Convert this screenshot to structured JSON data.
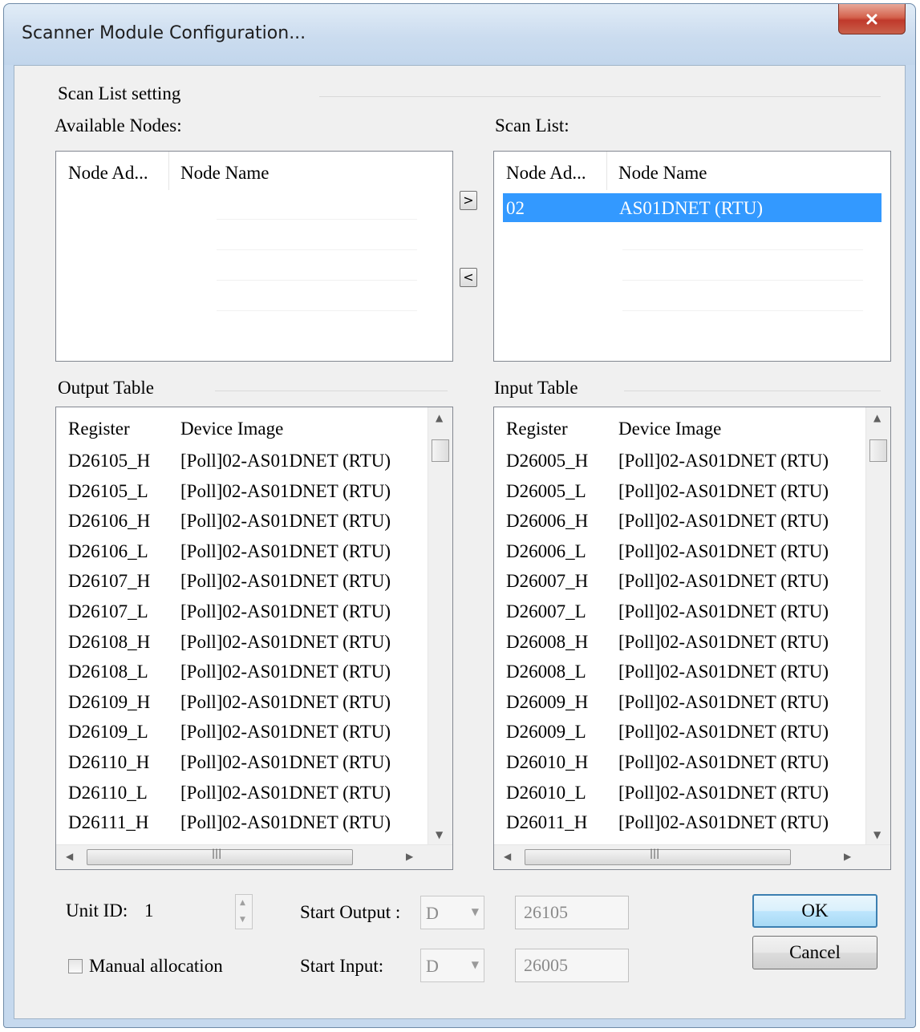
{
  "window": {
    "title": "Scanner Module Configuration..."
  },
  "scan_list_setting": {
    "group_label": "Scan List setting",
    "available_label": "Available Nodes:",
    "scanlist_label": "Scan List:",
    "columns": [
      "Node Ad...",
      "Node Name"
    ],
    "available_nodes": [],
    "scan_list": [
      {
        "address": "02",
        "name": "AS01DNET (RTU)",
        "selected": true
      }
    ],
    "add_button": ">",
    "remove_button": "<"
  },
  "output_table": {
    "label": "Output Table",
    "columns": [
      "Register",
      "Device Image"
    ],
    "rows": [
      [
        "D26105_H",
        "[Poll]02-AS01DNET (RTU)"
      ],
      [
        "D26105_L",
        "[Poll]02-AS01DNET (RTU)"
      ],
      [
        "D26106_H",
        "[Poll]02-AS01DNET (RTU)"
      ],
      [
        "D26106_L",
        "[Poll]02-AS01DNET (RTU)"
      ],
      [
        "D26107_H",
        "[Poll]02-AS01DNET (RTU)"
      ],
      [
        "D26107_L",
        "[Poll]02-AS01DNET (RTU)"
      ],
      [
        "D26108_H",
        "[Poll]02-AS01DNET (RTU)"
      ],
      [
        "D26108_L",
        "[Poll]02-AS01DNET (RTU)"
      ],
      [
        "D26109_H",
        "[Poll]02-AS01DNET (RTU)"
      ],
      [
        "D26109_L",
        "[Poll]02-AS01DNET (RTU)"
      ],
      [
        "D26110_H",
        "[Poll]02-AS01DNET (RTU)"
      ],
      [
        "D26110_L",
        "[Poll]02-AS01DNET (RTU)"
      ],
      [
        "D26111_H",
        "[Poll]02-AS01DNET (RTU)"
      ]
    ]
  },
  "input_table": {
    "label": "Input Table",
    "columns": [
      "Register",
      "Device Image"
    ],
    "rows": [
      [
        "D26005_H",
        "[Poll]02-AS01DNET (RTU)"
      ],
      [
        "D26005_L",
        "[Poll]02-AS01DNET (RTU)"
      ],
      [
        "D26006_H",
        "[Poll]02-AS01DNET (RTU)"
      ],
      [
        "D26006_L",
        "[Poll]02-AS01DNET (RTU)"
      ],
      [
        "D26007_H",
        "[Poll]02-AS01DNET (RTU)"
      ],
      [
        "D26007_L",
        "[Poll]02-AS01DNET (RTU)"
      ],
      [
        "D26008_H",
        "[Poll]02-AS01DNET (RTU)"
      ],
      [
        "D26008_L",
        "[Poll]02-AS01DNET (RTU)"
      ],
      [
        "D26009_H",
        "[Poll]02-AS01DNET (RTU)"
      ],
      [
        "D26009_L",
        "[Poll]02-AS01DNET (RTU)"
      ],
      [
        "D26010_H",
        "[Poll]02-AS01DNET (RTU)"
      ],
      [
        "D26010_L",
        "[Poll]02-AS01DNET (RTU)"
      ],
      [
        "D26011_H",
        "[Poll]02-AS01DNET (RTU)"
      ]
    ]
  },
  "bottom": {
    "unit_id_label": "Unit ID:",
    "unit_id_value": "1",
    "manual_allocation_label": "Manual allocation",
    "manual_allocation_checked": false,
    "start_output_label": "Start Output :",
    "start_output_device": "D",
    "start_output_value": "26105",
    "start_input_label": "Start Input:",
    "start_input_device": "D",
    "start_input_value": "26005",
    "ok_label": "OK",
    "cancel_label": "Cancel"
  },
  "icons": {
    "close": "close-icon",
    "scroll_up": "scroll-up-arrow-icon",
    "scroll_down": "scroll-down-arrow-icon",
    "scroll_left": "scroll-left-arrow-icon",
    "scroll_right": "scroll-right-arrow-icon",
    "dropdown": "dropdown-arrow-icon",
    "spin": "spin-arrows-icon"
  },
  "colors": {
    "selection": "#3399ff",
    "close_button": "#c0392b",
    "default_button_border": "#3c7fb1"
  }
}
